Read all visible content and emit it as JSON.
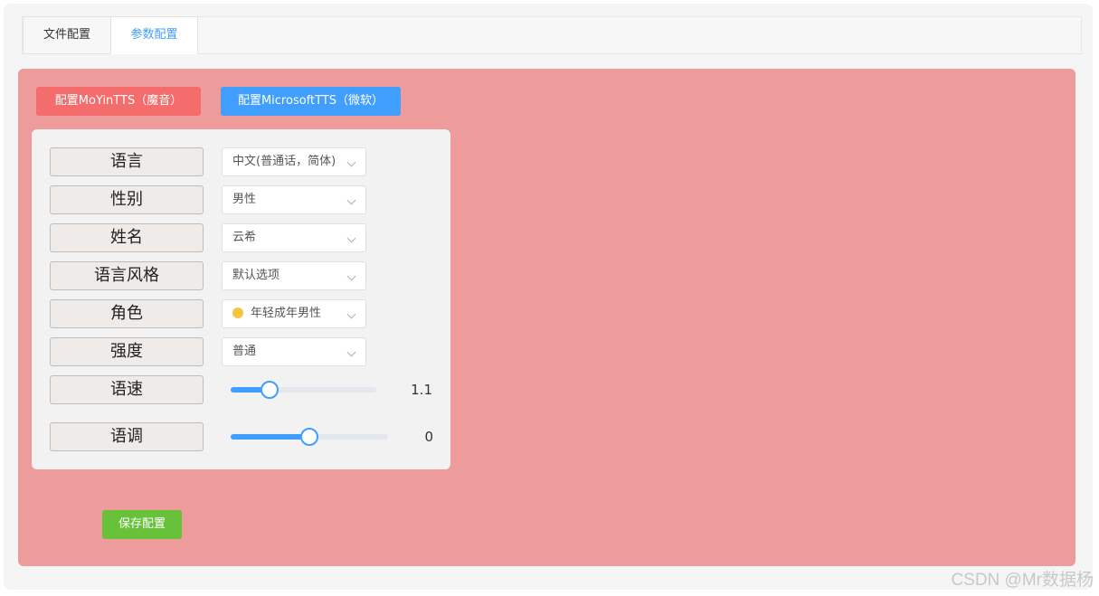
{
  "tabs": [
    {
      "label": "文件配置",
      "active": false
    },
    {
      "label": "参数配置",
      "active": true
    }
  ],
  "buttons": {
    "moyin": "配置MoYinTTS（魔音）",
    "microsoft": "配置MicrosoftTTS（微软）",
    "save": "保存配置"
  },
  "form": {
    "language": {
      "label": "语言",
      "value": "中文(普通话，简体)"
    },
    "gender": {
      "label": "性别",
      "value": "男性"
    },
    "name": {
      "label": "姓名",
      "value": "云希"
    },
    "style": {
      "label": "语言风格",
      "value": "默认选项"
    },
    "role": {
      "label": "角色",
      "value": "年轻成年男性",
      "icon": "person-emoji-icon"
    },
    "strength": {
      "label": "强度",
      "value": "普通"
    },
    "speed": {
      "label": "语速",
      "value": "1.1",
      "fill_fraction": 0.27
    },
    "pitch": {
      "label": "语调",
      "value": "0",
      "fill_fraction": 0.5
    }
  },
  "colors": {
    "panel": "#ee9b9b",
    "moyin": "#f56c6c",
    "microsoft": "#409eff",
    "save": "#67c23a",
    "accent": "#409eff"
  },
  "watermark": "CSDN @Mr数据杨"
}
